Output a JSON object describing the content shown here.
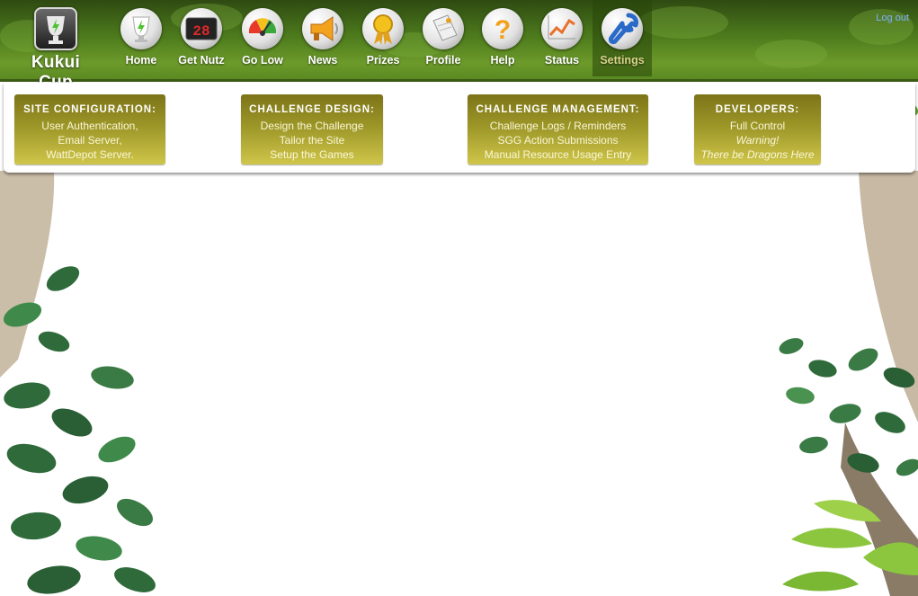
{
  "logo": {
    "text": "Kukui Cup",
    "icon": "trophy-icon"
  },
  "nav": {
    "items": [
      {
        "label": "Home",
        "icon": "trophy-icon"
      },
      {
        "label": "Get Nutz",
        "icon": "scoreboard-icon",
        "display": "28"
      },
      {
        "label": "Go Low",
        "icon": "gauge-icon"
      },
      {
        "label": "News",
        "icon": "megaphone-icon"
      },
      {
        "label": "Prizes",
        "icon": "ribbon-icon"
      },
      {
        "label": "Profile",
        "icon": "tag-icon"
      },
      {
        "label": "Help",
        "icon": "question-icon"
      },
      {
        "label": "Status",
        "icon": "chart-icon"
      },
      {
        "label": "Settings",
        "icon": "wrench-icon",
        "active": true
      }
    ],
    "logout_label": "Log out"
  },
  "admin": {
    "site_configuration": {
      "heading": "SITE CONFIGURATION:",
      "links": [
        "User Authentication,",
        "Email Server,",
        "WattDepot Server."
      ]
    },
    "challenge_design": {
      "heading": "CHALLENGE DESIGN:",
      "links": [
        "Design the Challenge",
        "Tailor the Site",
        "Setup the Games"
      ]
    },
    "challenge_management": {
      "heading": "CHALLENGE MANAGEMENT:",
      "links": [
        "Challenge Logs / Reminders",
        "SGG Action Submissions",
        "Manual Resource Usage Entry"
      ]
    },
    "developers": {
      "heading": "DEVELOPERS:",
      "links": [
        "Full Control"
      ],
      "warning": [
        "Warning!",
        "There be Dragons Here"
      ]
    }
  },
  "colors": {
    "nav_green": "#4c7a1c",
    "box_olive": "#9c9628",
    "active_label": "#d8d48a",
    "logout_link": "#7fb0ff"
  }
}
